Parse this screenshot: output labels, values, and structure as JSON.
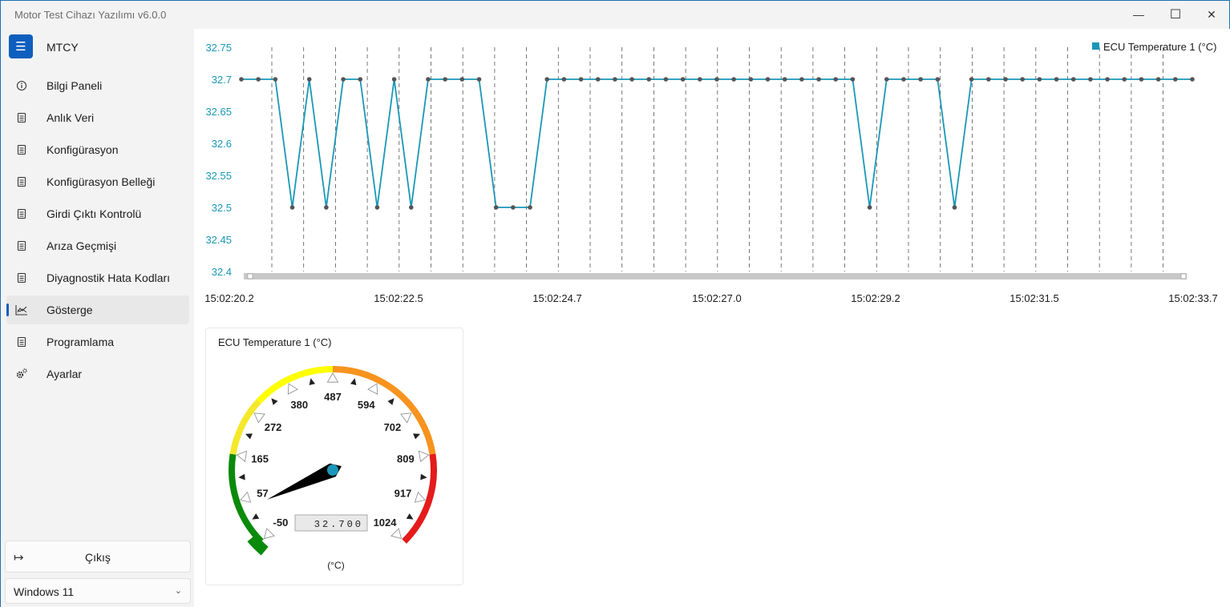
{
  "window": {
    "title": "Motor Test Cihazı Yazılımı v6.0.0",
    "minimize": "—",
    "maximize": "☐",
    "close": "✕"
  },
  "sidebar": {
    "app_name": "MTCY",
    "menu_icon": "hamburger-icon",
    "items": [
      {
        "label": "Bilgi Paneli",
        "icon": "info-icon"
      },
      {
        "label": "Anlık Veri",
        "icon": "document-icon"
      },
      {
        "label": "Konfigürasyon",
        "icon": "document-icon"
      },
      {
        "label": "Konfigürasyon Belleği",
        "icon": "document-icon"
      },
      {
        "label": "Girdi Çıktı Kontrolü",
        "icon": "document-icon"
      },
      {
        "label": "Arıza Geçmişi",
        "icon": "document-icon"
      },
      {
        "label": "Diyagnostik Hata Kodları",
        "icon": "document-icon"
      },
      {
        "label": "Gösterge",
        "icon": "chart-icon",
        "selected": true
      },
      {
        "label": "Programlama",
        "icon": "document-icon"
      },
      {
        "label": "Ayarlar",
        "icon": "gear-icon"
      }
    ],
    "exit_label": "Çıkış",
    "theme_value": "Windows 11",
    "accent_color": "#0e5fbd"
  },
  "chart_data": {
    "type": "line",
    "legend": "ECU Temperature 1 (°C)",
    "legend_position": "top-right",
    "series_color": "#1a97b8",
    "ylim": [
      32.4,
      32.75
    ],
    "yticks": [
      "32.75",
      "32.7",
      "32.65",
      "32.6",
      "32.55",
      "32.5",
      "32.45",
      "32.4"
    ],
    "xticks": [
      "15:02:20.2",
      "15:02:22.5",
      "15:02:24.7",
      "15:02:27.0",
      "15:02:29.2",
      "15:02:31.5",
      "15:02:33.7"
    ],
    "grid": "vertical dashed",
    "values": [
      32.7,
      32.7,
      32.7,
      32.5,
      32.7,
      32.5,
      32.7,
      32.7,
      32.5,
      32.7,
      32.5,
      32.7,
      32.7,
      32.7,
      32.7,
      32.5,
      32.5,
      32.5,
      32.7,
      32.7,
      32.7,
      32.7,
      32.7,
      32.7,
      32.7,
      32.7,
      32.7,
      32.7,
      32.7,
      32.7,
      32.7,
      32.7,
      32.7,
      32.7,
      32.7,
      32.7,
      32.7,
      32.5,
      32.7,
      32.7,
      32.7,
      32.7,
      32.5,
      32.7,
      32.7,
      32.7,
      32.7,
      32.7,
      32.7,
      32.7,
      32.7,
      32.7,
      32.7,
      32.7,
      32.7,
      32.7,
      32.7
    ]
  },
  "gauge": {
    "title": "ECU Temperature 1 (°C)",
    "min": -50,
    "max": 1024,
    "value": 32.7,
    "display": "32.700",
    "unit": "(°C)",
    "labels": [
      "-50",
      "57",
      "165",
      "272",
      "380",
      "487",
      "594",
      "702",
      "809",
      "917",
      "1024"
    ],
    "bands": [
      {
        "from": -50,
        "to": 165,
        "color": "#0a8a0a"
      },
      {
        "from": 165,
        "to": 300,
        "color": "#f5e82a"
      },
      {
        "from": 300,
        "to": 487,
        "color": "#ffff00"
      },
      {
        "from": 487,
        "to": 702,
        "color": "#f7931e"
      },
      {
        "from": 702,
        "to": 809,
        "color": "#f7931e"
      },
      {
        "from": 809,
        "to": 1024,
        "color": "#e41b1b"
      }
    ]
  }
}
